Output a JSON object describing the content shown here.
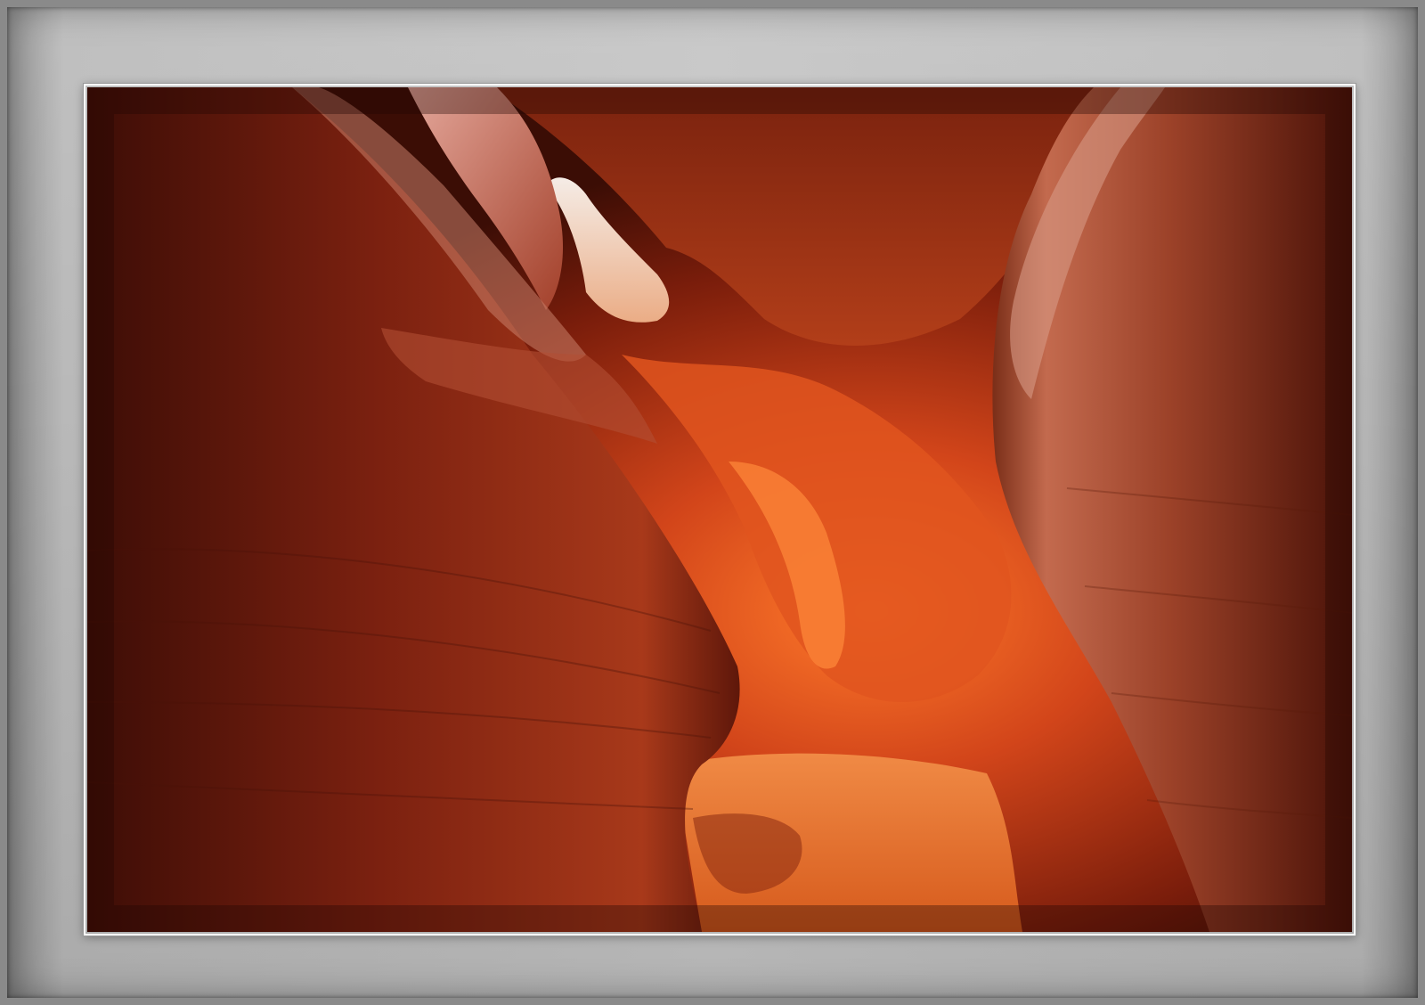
{
  "image": {
    "subject": "slot-canyon-photograph",
    "colors": {
      "mat_light": "#c4c4c4",
      "mat_dark": "#8a8a8a",
      "rock_dark": "#3a0c05",
      "rock_mid": "#8f2a12",
      "rock_glow": "#e8551b",
      "sky_light": "#f3e7e1",
      "sand": "#e9702c"
    }
  }
}
